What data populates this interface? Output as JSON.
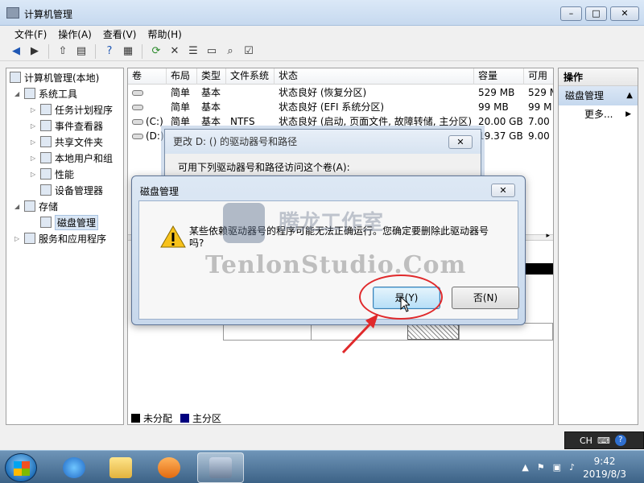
{
  "window": {
    "title": "计算机管理",
    "buttons": {
      "min": "–",
      "max": "□",
      "close": "✕"
    }
  },
  "menu": [
    "文件(F)",
    "操作(A)",
    "查看(V)",
    "帮助(H)"
  ],
  "tree": {
    "root": "计算机管理(本地)",
    "system_tools": "系统工具",
    "task_scheduler": "任务计划程序",
    "event_viewer": "事件查看器",
    "shared_folders": "共享文件夹",
    "local_users": "本地用户和组",
    "performance": "性能",
    "device_manager": "设备管理器",
    "storage": "存储",
    "disk_management": "磁盘管理",
    "services_apps": "服务和应用程序"
  },
  "table": {
    "headers": [
      "卷",
      "布局",
      "类型",
      "文件系统",
      "状态",
      "容量",
      "可用"
    ],
    "rows": [
      {
        "vol": "",
        "layout": "简单",
        "type": "基本",
        "fs": "",
        "status": "状态良好 (恢复分区)",
        "cap": "529 MB",
        "free": "529 M"
      },
      {
        "vol": "",
        "layout": "简单",
        "type": "基本",
        "fs": "",
        "status": "状态良好 (EFI 系统分区)",
        "cap": "99 MB",
        "free": "99 M"
      },
      {
        "vol": "(C:)",
        "layout": "简单",
        "type": "基本",
        "fs": "NTFS",
        "status": "状态良好 (启动, 页面文件, 故障转储, 主分区)",
        "cap": "20.00 GB",
        "free": "7.00"
      },
      {
        "vol": "(D:)",
        "layout": "",
        "type": "",
        "fs": "",
        "status": "",
        "cap": "19.37 GB",
        "free": "9.00"
      }
    ]
  },
  "legend": {
    "unalloc": "未分配",
    "primary": "主分区",
    "unalloc_color": "#000000",
    "primary_color": "#00007f"
  },
  "actions": {
    "header": "操作",
    "section": "磁盘管理",
    "more": "更多..."
  },
  "bg_dialog": {
    "title": "更改 D: () 的驱动器号和路径",
    "text": "可用下列驱动器号和路径访问这个卷(A):"
  },
  "confirm": {
    "title": "磁盘管理",
    "message": "某些依赖驱动器号的程序可能无法正确运行。您确定要删除此驱动器号吗?",
    "yes": "是(Y)",
    "no": "否(N)"
  },
  "watermark": {
    "cn": "腾龙工作室",
    "en": "TenlonStudio.Com"
  },
  "lang_bar": {
    "code": "CH",
    "help": "?"
  },
  "clock": {
    "time": "9:42",
    "date": "2019/8/3"
  }
}
